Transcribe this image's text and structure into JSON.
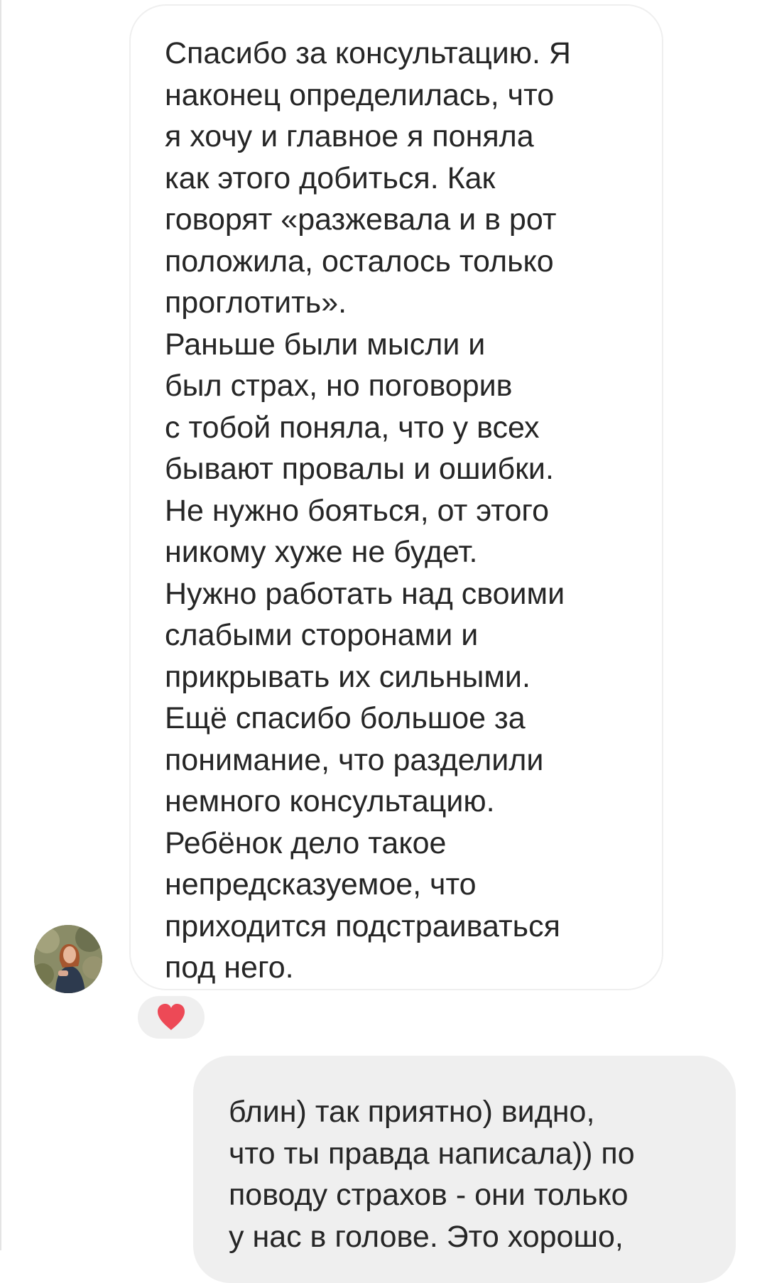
{
  "thread": {
    "incoming_message": {
      "text": "Спасибо за консультацию. Я\nнаконец определилась, что\nя хочу и главное я поняла\nкак этого добиться. Как\nговорят «разжевала и в рот\nположила, осталось только\nпроглотить».\nРаньше были мысли и\nбыл страх, но поговорив\nс тобой поняла, что у всех\nбывают провалы и ошибки.\nНе нужно бояться, от этого\nникому хуже не будет.\nНужно работать над своими\nслабыми сторонами и\nприкрывать их сильными.\nЕщё спасибо большое за\nпонимание, что разделили\nнемного консультацию.\nРебёнок дело такое\nнепредсказуемое, что\nприходится подстраиваться\nпод него.",
      "reaction_icon": "heart-icon",
      "reaction_color": "#ed4956"
    },
    "outgoing_message": {
      "text": "блин) так приятно) видно,\nчто ты правда написала)) по\nповоду страхов - они только\nу нас в голове. Это хорошо,"
    },
    "colors": {
      "incoming_bubble_border": "#efefef",
      "outgoing_bubble_bg": "#efefef",
      "text": "#262626"
    }
  }
}
